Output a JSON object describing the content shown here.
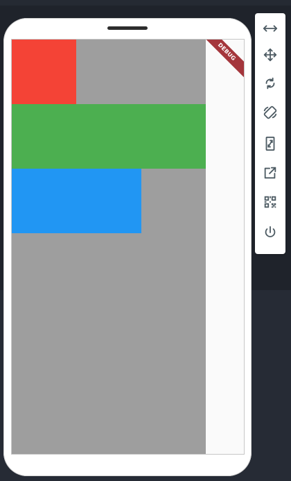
{
  "window": {
    "background_color": "#1f232b",
    "lower_background_color": "#262b35"
  },
  "device": {
    "frame_color": "#ffffff",
    "speaker_color": "#2d2d2d"
  },
  "app": {
    "background_color": "#9e9e9e",
    "boxes": [
      {
        "name": "red-box",
        "color": "#f44336"
      },
      {
        "name": "green-box",
        "color": "#4caf50"
      },
      {
        "name": "blue-box",
        "color": "#2196f3"
      }
    ],
    "debug_banner": {
      "label": "DEBUG",
      "color": "#a4363c"
    }
  },
  "toolbar": {
    "icon_color": "#4d5b63",
    "tools": [
      {
        "icon": "resize-horizontal-icon"
      },
      {
        "icon": "move-icon"
      },
      {
        "icon": "rotate-icon"
      },
      {
        "icon": "screen-rotation-icon"
      },
      {
        "icon": "resize-diagonal-icon"
      },
      {
        "icon": "open-external-icon"
      },
      {
        "icon": "qr-code-icon"
      },
      {
        "icon": "power-icon"
      }
    ]
  }
}
